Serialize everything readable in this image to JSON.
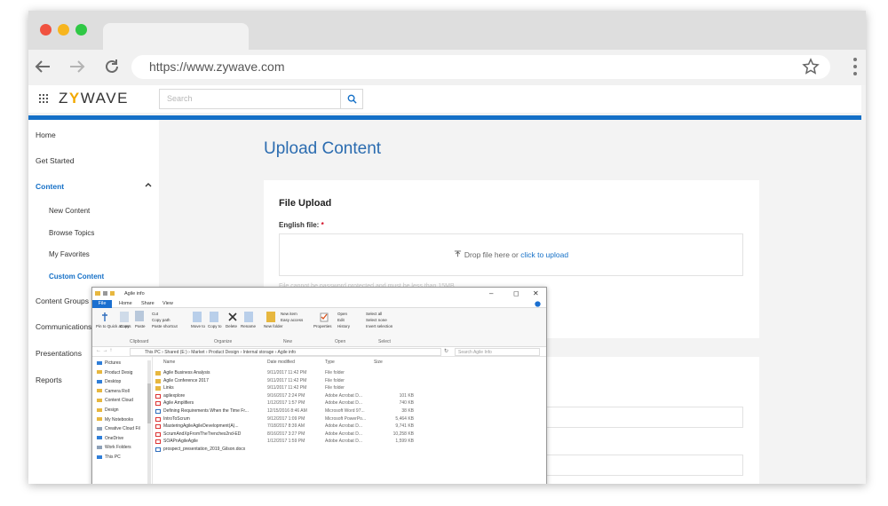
{
  "browser": {
    "url": "https://www.zywave.com",
    "icons": [
      "back-arrow-icon",
      "forward-arrow-icon",
      "reload-icon",
      "star-icon",
      "kebab-menu-icon"
    ]
  },
  "app": {
    "logo_left": "Z",
    "logo_mark": "Y",
    "logo_right": "WAVE",
    "search_placeholder": "Search",
    "accent": "#1570c7"
  },
  "sidebar": {
    "items": [
      {
        "label": "Home"
      },
      {
        "label": "Get Started"
      },
      {
        "label": "Content"
      },
      {
        "label": "New Content"
      },
      {
        "label": "Browse Topics"
      },
      {
        "label": "My Favorites"
      },
      {
        "label": "Custom Content"
      },
      {
        "label": "Content Groups"
      },
      {
        "label": "Communications"
      },
      {
        "label": "Presentations"
      },
      {
        "label": "Reports"
      }
    ]
  },
  "main": {
    "title": "Upload Content",
    "card_title": "File Upload",
    "field_label": "English file:",
    "required_mark": "*",
    "drop_text": "Drop file here or",
    "drop_link": "click to upload",
    "hint": "File cannot be password protected and must be less than 15MB"
  },
  "explorer": {
    "title": "Agile info",
    "tabs": [
      "File",
      "Home",
      "Share",
      "View"
    ],
    "ribbon": {
      "pin": "Pin to Quick access",
      "copy": "Copy",
      "paste": "Paste",
      "cut": "Cut",
      "copy_path": "Copy path",
      "paste_shortcut": "Paste shortcut",
      "move_to": "Move to",
      "copy_to": "Copy to",
      "delete": "Delete",
      "rename": "Rename",
      "new_folder": "New folder",
      "new_item": "New item",
      "easy_access": "Easy access",
      "properties": "Properties",
      "open": "Open",
      "edit": "Edit",
      "history": "History",
      "select_all": "Select all",
      "select_none": "Select none",
      "invert_selection": "Invert selection",
      "groups": [
        "Clipboard",
        "Organize",
        "New",
        "Open",
        "Select"
      ]
    },
    "path": "This PC  ›  Shared (E:)  ›  Market  ›  Product Design  ›  Internal storage  ›  Agile info",
    "search_placeholder": "Search Agile Info",
    "nav": [
      {
        "label": "Pictures",
        "color": "blue"
      },
      {
        "label": "Product Desig",
        "color": "folder"
      },
      {
        "label": "Desktop",
        "color": "blue"
      },
      {
        "label": "Camera Roll",
        "color": "folder"
      },
      {
        "label": "Content Cloud",
        "color": "folder"
      },
      {
        "label": "Design",
        "color": "folder"
      },
      {
        "label": "My Notebooks",
        "color": "folder"
      },
      {
        "label": "Creative Cloud Fil",
        "color": "gray"
      },
      {
        "label": "OneDrive",
        "color": "blue"
      },
      {
        "label": "Work Folders",
        "color": "gray"
      },
      {
        "label": "This PC",
        "color": "blue"
      }
    ],
    "columns": {
      "name": "Name",
      "date": "Date modified",
      "type": "Type",
      "size": "Size"
    },
    "files": [
      {
        "name": "Agile Business Analysis",
        "date": "9/11/2017 11:42 PM",
        "type": "File folder",
        "size": "",
        "kind": "folder"
      },
      {
        "name": "Agile Conference 2017",
        "date": "9/11/2017 11:42 PM",
        "type": "File folder",
        "size": "",
        "kind": "folder"
      },
      {
        "name": "Links",
        "date": "9/11/2017 11:42 PM",
        "type": "File folder",
        "size": "",
        "kind": "folder"
      },
      {
        "name": "agilexplore",
        "date": "9/16/2017 2:24 PM",
        "type": "Adobe Acrobat D...",
        "size": "101 KB",
        "kind": "pdf"
      },
      {
        "name": "Agile Amplifiers",
        "date": "1/12/2017 1:57 PM",
        "type": "Adobe Acrobat D...",
        "size": "740 KB",
        "kind": "pdf"
      },
      {
        "name": "Defining Requirements When the Time Fr...",
        "date": "12/15/2016 8:46 AM",
        "type": "Microsoft Word 97...",
        "size": "38 KB",
        "kind": "doc"
      },
      {
        "name": "IntroToScrum",
        "date": "9/12/2017 1:09 PM",
        "type": "Microsoft PowerPo...",
        "size": "5,464 KB",
        "kind": "pdf"
      },
      {
        "name": "MasteringAgileAgileDevelopment(A)...",
        "date": "7/18/2017 8:39 AM",
        "type": "Adobe Acrobat D...",
        "size": "9,741 KB",
        "kind": "pdf"
      },
      {
        "name": "ScrumAndXpFromTheTrenches2nd-ED",
        "date": "8/16/2017 3:27 PM",
        "type": "Adobe Acrobat D...",
        "size": "10,258 KB",
        "kind": "pdf"
      },
      {
        "name": "SOAPnAgileAgile",
        "date": "1/12/2017 1:59 PM",
        "type": "Adobe Acrobat D...",
        "size": "1,599 KB",
        "kind": "pdf"
      },
      {
        "name": "prospect_presentation_2019_Gilson.docx",
        "date": "",
        "type": "",
        "size": "",
        "kind": "doc"
      }
    ]
  }
}
